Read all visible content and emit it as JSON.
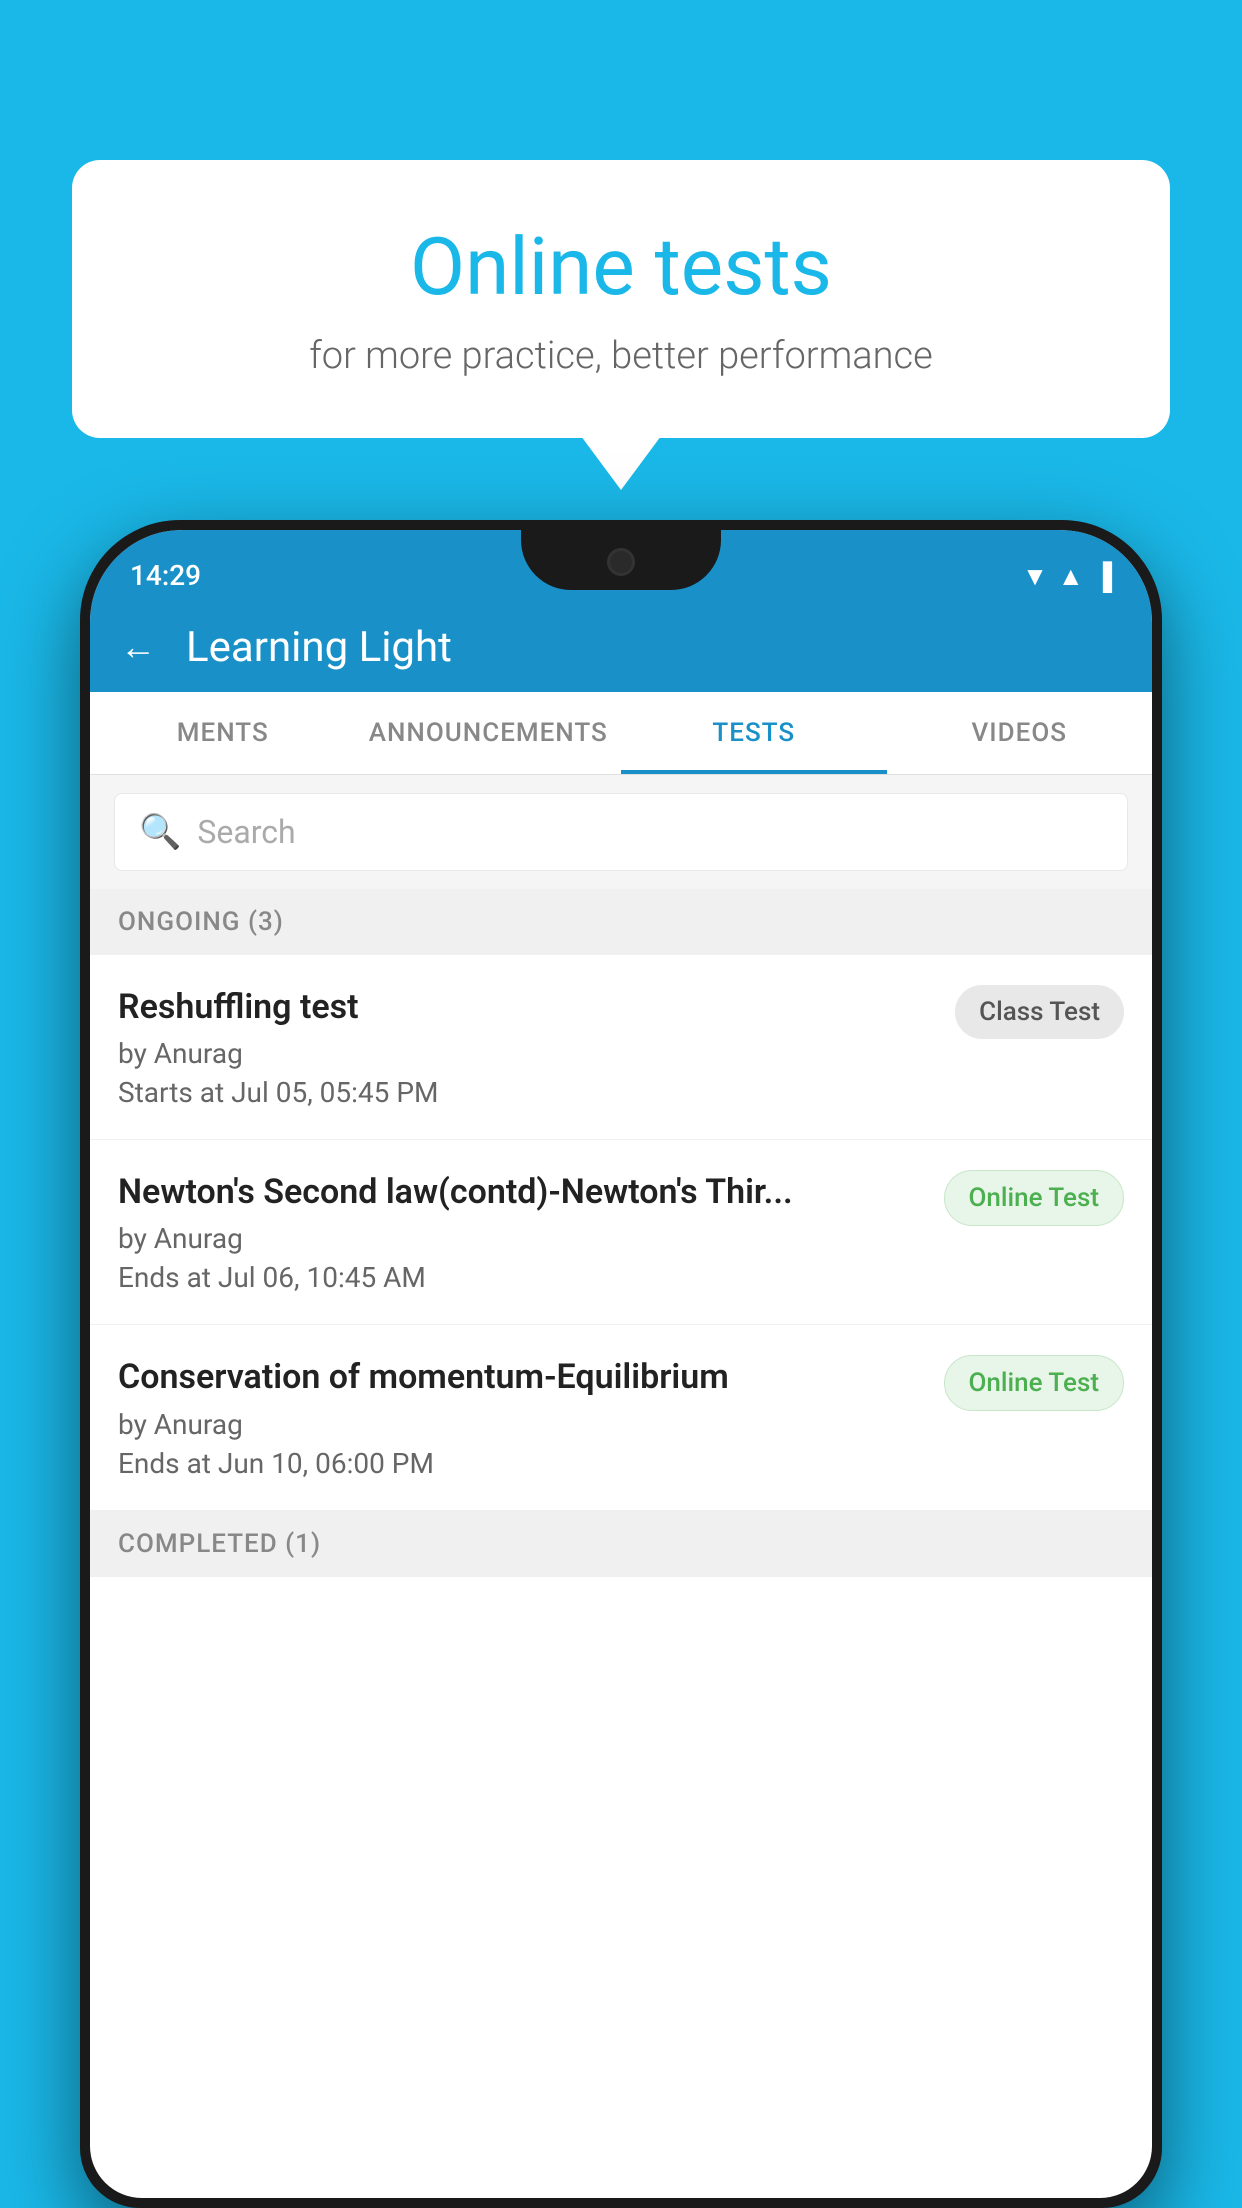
{
  "background": {
    "color": "#1ab8e8"
  },
  "bubble": {
    "title": "Online tests",
    "subtitle": "for more practice, better performance"
  },
  "phone": {
    "status_bar": {
      "time": "14:29"
    },
    "header": {
      "title": "Learning Light",
      "back_label": "←"
    },
    "tabs": [
      {
        "label": "MENTS",
        "active": false
      },
      {
        "label": "ANNOUNCEMENTS",
        "active": false
      },
      {
        "label": "TESTS",
        "active": true
      },
      {
        "label": "VIDEOS",
        "active": false
      }
    ],
    "search": {
      "placeholder": "Search"
    },
    "ongoing_section": {
      "label": "ONGOING (3)"
    },
    "tests": [
      {
        "title": "Reshuffling test",
        "author": "by Anurag",
        "date": "Starts at  Jul 05, 05:45 PM",
        "badge": "Class Test",
        "badge_type": "class"
      },
      {
        "title": "Newton's Second law(contd)-Newton's Thir...",
        "author": "by Anurag",
        "date": "Ends at  Jul 06, 10:45 AM",
        "badge": "Online Test",
        "badge_type": "online"
      },
      {
        "title": "Conservation of momentum-Equilibrium",
        "author": "by Anurag",
        "date": "Ends at  Jun 10, 06:00 PM",
        "badge": "Online Test",
        "badge_type": "online"
      }
    ],
    "completed_section": {
      "label": "COMPLETED (1)"
    }
  }
}
